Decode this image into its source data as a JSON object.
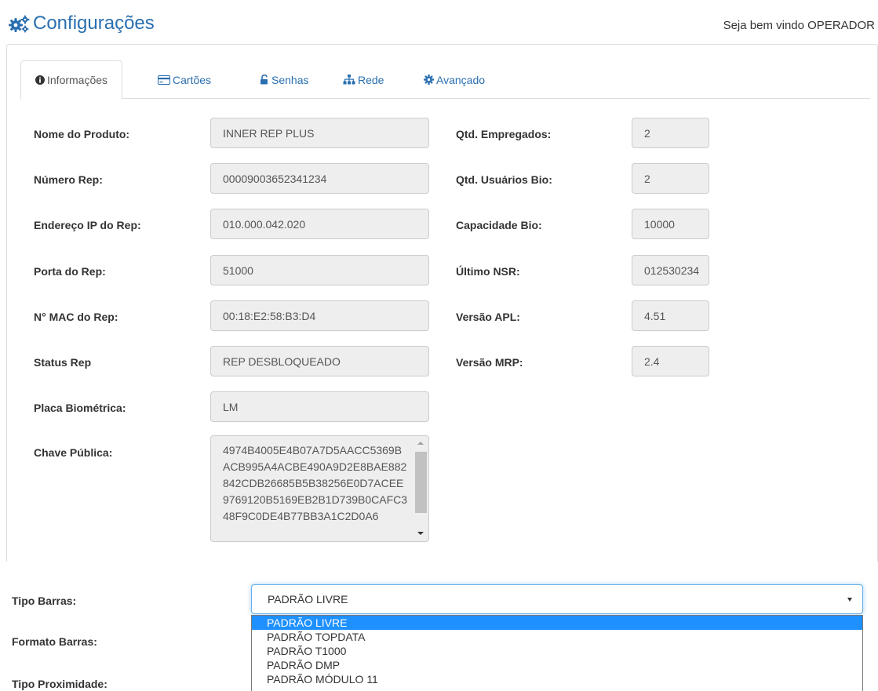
{
  "header": {
    "title": "Configurações",
    "welcome": "Seja bem vindo OPERADOR"
  },
  "tabs": [
    {
      "label": "Informações",
      "icon": "info-icon",
      "active": true
    },
    {
      "label": "Cartões",
      "icon": "credit-card-icon"
    },
    {
      "label": "Senhas",
      "icon": "unlock-icon"
    },
    {
      "label": "Rede",
      "icon": "sitemap-icon"
    },
    {
      "label": "Avançado",
      "icon": "gear-icon"
    }
  ],
  "info_left": [
    {
      "label": "Nome do Produto:",
      "value": "INNER REP PLUS"
    },
    {
      "label": "Número Rep:",
      "value": "00009003652341234"
    },
    {
      "label": "Endereço IP do Rep:",
      "value": "010.000.042.020"
    },
    {
      "label": "Porta do Rep:",
      "value": "51000"
    },
    {
      "label": "N° MAC do Rep:",
      "value": "00:18:E2:58:B3:D4"
    },
    {
      "label": "Status Rep",
      "value": "REP DESBLOQUEADO"
    },
    {
      "label": "Placa Biométrica:",
      "value": "LM"
    }
  ],
  "info_right": [
    {
      "label": "Qtd. Empregados:",
      "value": "2"
    },
    {
      "label": "Qtd. Usuários Bio:",
      "value": "2"
    },
    {
      "label": "Capacidade Bio:",
      "value": "10000"
    },
    {
      "label": "Último NSR:",
      "value": "012530234"
    },
    {
      "label": "Versão APL:",
      "value": "4.51"
    },
    {
      "label": "Versão MRP:",
      "value": "2.4"
    }
  ],
  "public_key": {
    "label": "Chave Pública:",
    "value": "4974B4005E4B07A7D5AACC5369BACB995A4ACBE490A9D2E8BAE882842CDB26685B5B38256E0D7ACEE9769120B5169EB2B1D739B0CAFC348F9C0DE4B77BB3A1C2D0A6"
  },
  "bottom": {
    "labels": {
      "tipo_barras": "Tipo Barras:",
      "formato_barras": "Formato Barras:",
      "tipo_proximidade": "Tipo Proximidade:"
    },
    "select_value": "PADRÃO LIVRE",
    "options": [
      "PADRÃO LIVRE",
      "PADRÃO TOPDATA",
      "PADRÃO T1000",
      "PADRÃO DMP",
      "PADRÃO MÓDULO 11"
    ]
  },
  "colors": {
    "accent": "#2a6fb0",
    "selected_option": "#1e90ff"
  }
}
